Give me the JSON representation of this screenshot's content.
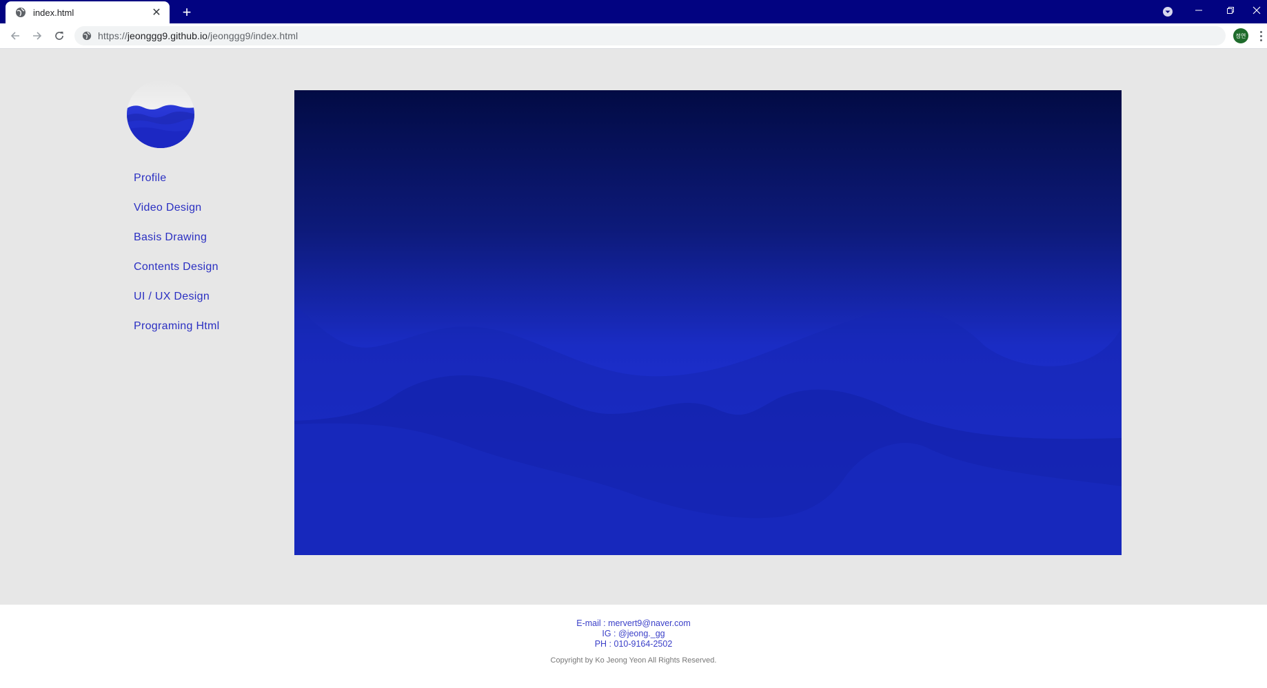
{
  "browser": {
    "tab_title": "index.html",
    "new_tab_label": "+",
    "close_tab_label": "✕",
    "url_scheme": "https://",
    "url_host": "jeonggg9.github.io",
    "url_path": "/jeonggg9/index.html",
    "profile_initials": "정연",
    "colors": {
      "titlebar": "#020381",
      "profile": "#1e6b2b"
    }
  },
  "sidebar": {
    "items": [
      {
        "label": "Profile"
      },
      {
        "label": "Video Design"
      },
      {
        "label": "Basis Drawing"
      },
      {
        "label": "Contents Design"
      },
      {
        "label": "UI / UX Design"
      },
      {
        "label": "Programing Html"
      }
    ],
    "link_color": "#2a2fc2"
  },
  "hero": {
    "gradient_top": "#020b44",
    "gradient_bottom": "#2234e6"
  },
  "footer": {
    "email": "E-mail : mervert9@naver.com",
    "instagram": "IG : @jeong._gg",
    "phone": "PH : 010-9164-2502",
    "copyright": "Copyright by Ko Jeong Yeon All Rights Reserved."
  }
}
